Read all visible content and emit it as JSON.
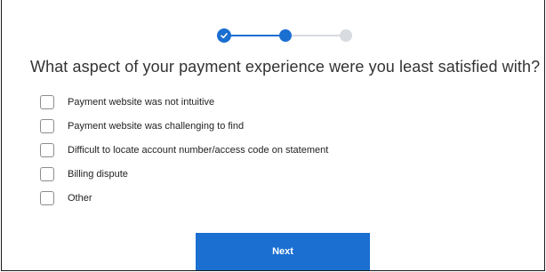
{
  "progress": {
    "current_step": 2,
    "total_steps": 3
  },
  "question": "What aspect of your payment experience were you least satisfied with?",
  "options": [
    {
      "label": "Payment website was not intuitive",
      "checked": false
    },
    {
      "label": "Payment website was challenging to find",
      "checked": false
    },
    {
      "label": "Difficult to locate account number/access code on statement",
      "checked": false
    },
    {
      "label": "Billing dispute",
      "checked": false
    },
    {
      "label": "Other",
      "checked": false
    }
  ],
  "next_button": {
    "label": "Next"
  },
  "colors": {
    "accent": "#1a6fd1",
    "inactive": "#d8dbe0",
    "text": "#333333"
  }
}
